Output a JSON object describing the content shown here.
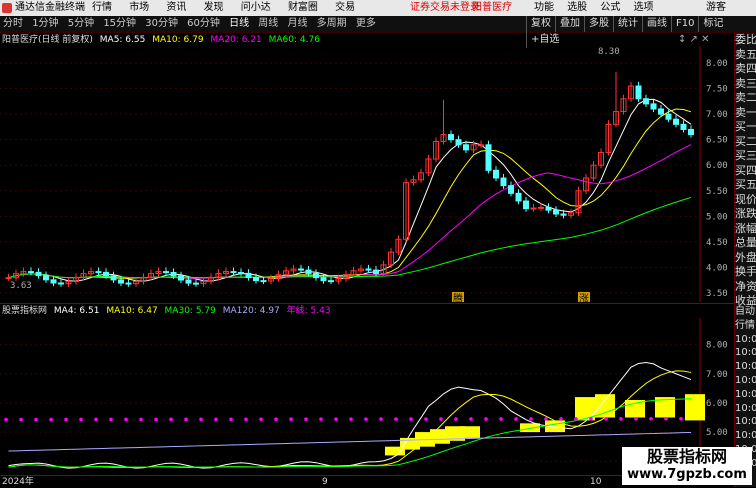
{
  "title_bar": {
    "app_name": "通达信金融终端",
    "menus": [
      "行情",
      "市场",
      "资讯",
      "发现",
      "问小达",
      "财富圈",
      "交易"
    ],
    "notice": "证券交易未登录",
    "stock_link": "阳普医疗",
    "right_menus": [
      "功能",
      "选股",
      "公式",
      "选项"
    ],
    "guest": "游客"
  },
  "toolbar": {
    "timeframes": [
      "分时",
      "1分钟",
      "5分钟",
      "15分钟",
      "30分钟",
      "60分钟",
      "日线",
      "周线",
      "月线",
      "多周期",
      "更多"
    ],
    "active_timeframe": "日线",
    "right_buttons": [
      "复权",
      "叠加",
      "多股",
      "统计",
      "画线",
      "F10",
      "标记",
      "+自选"
    ]
  },
  "main_legend": {
    "name": "阳普医疗(日线 前复权)",
    "ma5": "MA5: 6.55",
    "ma10": "MA10: 6.79",
    "ma20": "MA20: 6.21",
    "ma60": "MA60: 4.76"
  },
  "main_chart": {
    "y_ticks": [
      "8.00",
      "7.50",
      "7.00",
      "6.50",
      "6.00",
      "5.50",
      "5.00",
      "4.50",
      "4.00",
      "3.50"
    ],
    "high_label": "8.30",
    "low_label": "3.63",
    "markers": [
      "腾",
      "涨"
    ]
  },
  "sub_legend": {
    "name": "股票指标网",
    "ma4": "MA4: 6.51",
    "ma10": "MA10: 6.47",
    "ma30": "MA30: 5.79",
    "ma120": "MA120: 4.97",
    "yearline": "年线: 5.43"
  },
  "sub_chart": {
    "y_ticks": [
      "8.00",
      "7.00",
      "6.00",
      "5.00",
      "4.00"
    ]
  },
  "x_axis": {
    "labels": [
      "2024年",
      "9",
      "10"
    ]
  },
  "right_panel": {
    "labels": [
      "委比",
      "卖五",
      "卖四",
      "卖三",
      "卖二",
      "卖一",
      "买一",
      "买二",
      "买三",
      "买四",
      "买五",
      "现价",
      "涨跌",
      "涨幅",
      "总量",
      "外盘",
      "换手",
      "净资",
      "收益"
    ],
    "labels2": [
      "自动",
      "行情",
      "10:00",
      "10:00",
      "10:00",
      "10:00",
      "10:00",
      "10:00",
      "10:00",
      "10:00",
      "10:00",
      "10:00"
    ]
  },
  "watermark": {
    "title": "股票指标网",
    "url": "www.7gpzb.com"
  },
  "colors": {
    "up": "#ff3232",
    "down": "#54ffff",
    "ma5": "#ffffff",
    "ma10": "#ffff00",
    "ma20": "#ff00ff",
    "ma60": "#00ff00"
  }
}
